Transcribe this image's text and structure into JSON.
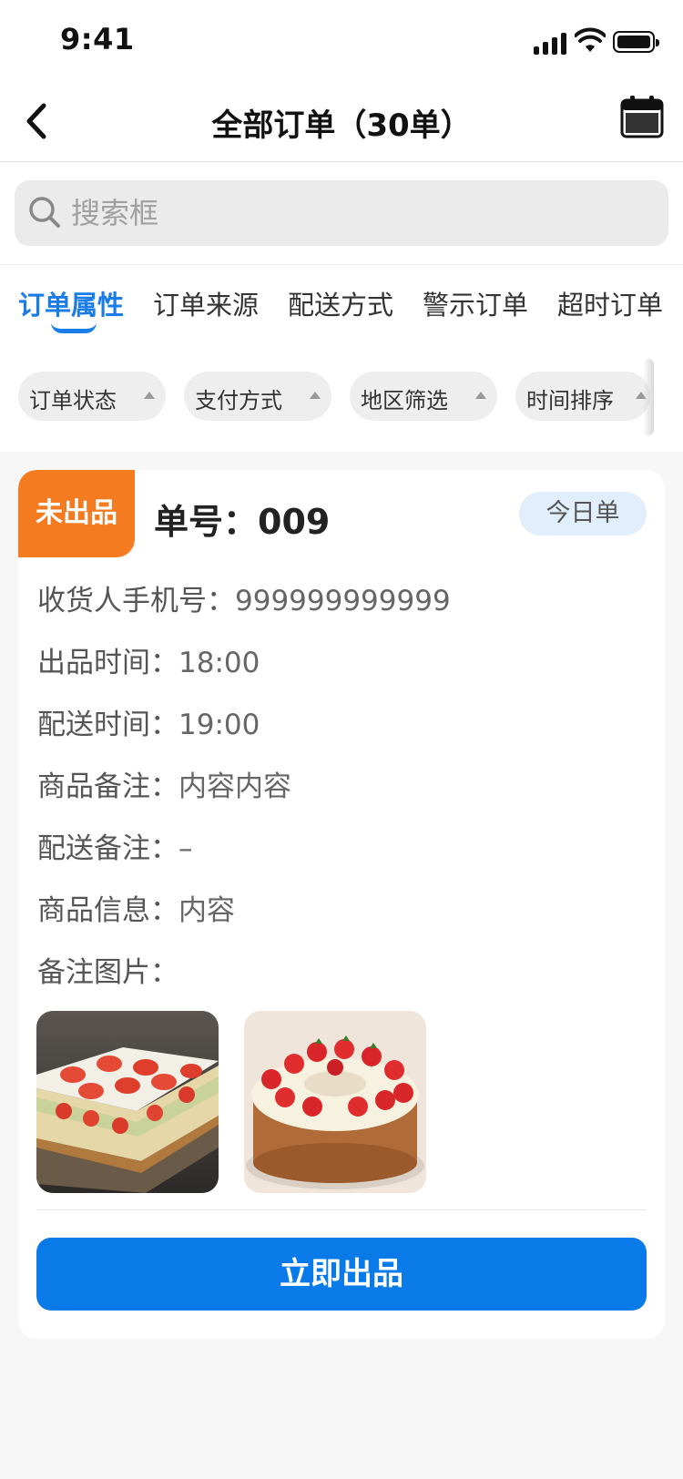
{
  "status_bar": {
    "time": "9:41"
  },
  "nav": {
    "title": "全部订单（30单）"
  },
  "search": {
    "placeholder": "搜索框"
  },
  "tabs": [
    {
      "label": "订单属性"
    },
    {
      "label": "订单来源"
    },
    {
      "label": "配送方式"
    },
    {
      "label": "警示订单"
    },
    {
      "label": "超时订单"
    }
  ],
  "filters": [
    {
      "label": "订单状态"
    },
    {
      "label": "支付方式"
    },
    {
      "label": "地区筛选"
    },
    {
      "label": "时间排序"
    }
  ],
  "order": {
    "status": "未出品",
    "number": "单号：009",
    "badge": "今日单",
    "fields": [
      {
        "label": "收货人手机号：",
        "value": "999999999999"
      },
      {
        "label": "出品时间：",
        "value": "18:00"
      },
      {
        "label": "配送时间：",
        "value": "19:00"
      },
      {
        "label": "商品备注：",
        "value": "内容内容"
      },
      {
        "label": "配送备注：",
        "value": "–"
      },
      {
        "label": "商品信息：",
        "value": "内容"
      },
      {
        "label": "备注图片：",
        "value": ""
      }
    ],
    "photos": [
      {
        "name": "strawberry-slab-cake"
      },
      {
        "name": "strawberry-cream-cake"
      }
    ],
    "action_label": "立即出品"
  },
  "colors": {
    "accent": "#0a7ae8",
    "status_tag": "#f47b20",
    "badge_bg": "#e1eefc"
  }
}
